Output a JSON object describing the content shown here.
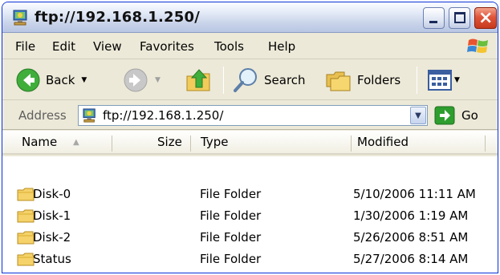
{
  "window": {
    "title": "ftp://192.168.1.250/",
    "close_glyph": "×"
  },
  "menu": {
    "items": [
      {
        "label": "File"
      },
      {
        "label": "Edit"
      },
      {
        "label": "View"
      },
      {
        "label": "Favorites"
      },
      {
        "label": "Tools"
      },
      {
        "label": "Help"
      }
    ]
  },
  "toolbar": {
    "back_label": "Back",
    "search_label": "Search",
    "folders_label": "Folders"
  },
  "address": {
    "label": "Address",
    "value": "ftp://192.168.1.250/",
    "go_label": "Go"
  },
  "columns": {
    "name": "Name",
    "size": "Size",
    "type": "Type",
    "modified": "Modified"
  },
  "files": [
    {
      "name": "Disk-0",
      "size": "",
      "type": "File Folder",
      "modified": "5/10/2006 11:11 AM"
    },
    {
      "name": "Disk-1",
      "size": "",
      "type": "File Folder",
      "modified": "1/30/2006 1:19 AM"
    },
    {
      "name": "Disk-2",
      "size": "",
      "type": "File Folder",
      "modified": "5/26/2006 8:51 AM"
    },
    {
      "name": "Status",
      "size": "",
      "type": "File Folder",
      "modified": "5/27/2006 8:14 AM"
    }
  ],
  "colors": {
    "accent_blue": "#0831d9",
    "folder_yellow": "#f5d26a",
    "go_green": "#2e9e2e",
    "close_red": "#e0553a"
  }
}
